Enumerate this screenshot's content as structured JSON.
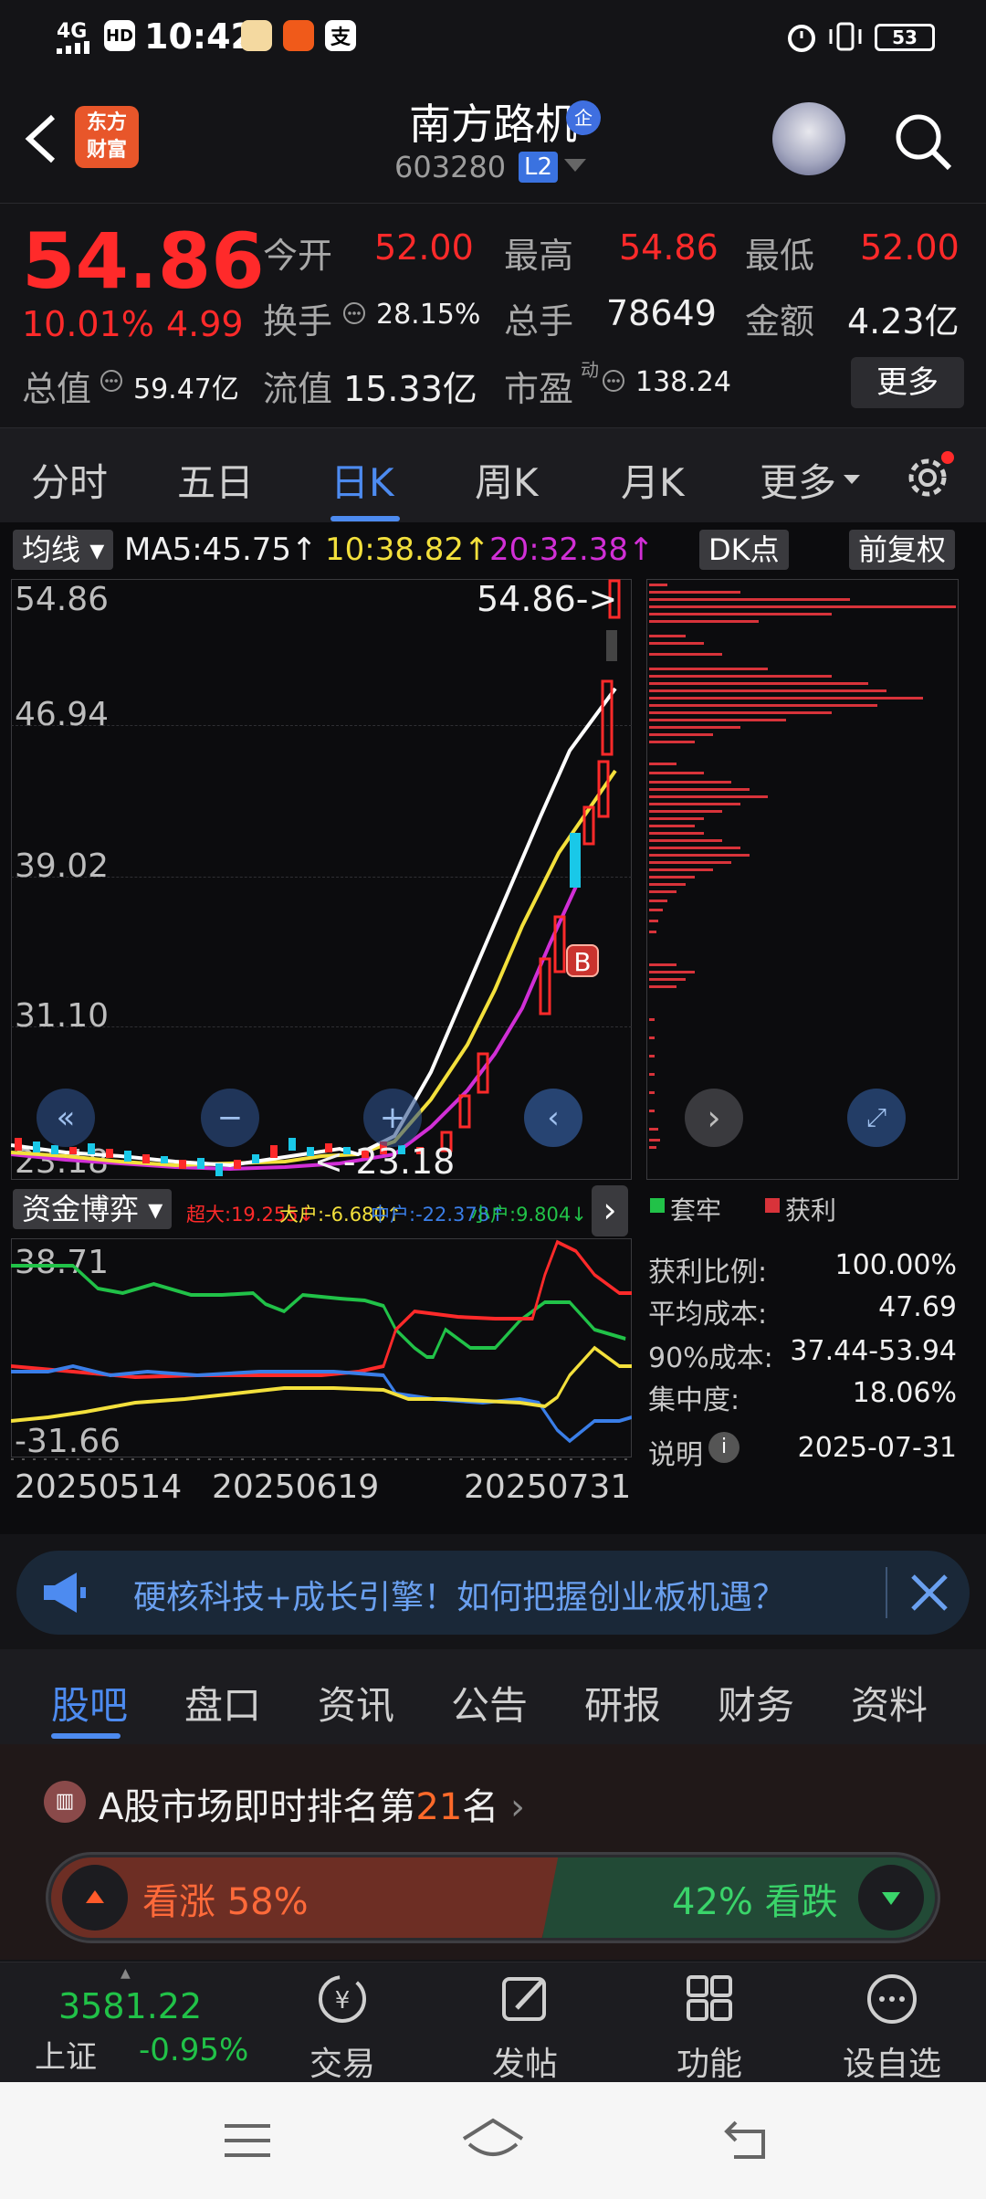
{
  "status": {
    "time": "10:42",
    "network": "4G",
    "battery": "53"
  },
  "header": {
    "name": "南方路机",
    "code": "603280",
    "l2": "L2",
    "badge": "企",
    "logo_line1": "东方",
    "logo_line2": "财富"
  },
  "quote": {
    "price": "54.86",
    "pct": "10.01%",
    "chg": "4.99",
    "fields": {
      "open_label": "今开",
      "open": "52.00",
      "high_label": "最高",
      "high": "54.86",
      "low_label": "最低",
      "low": "52.00",
      "turnover_label": "换手",
      "turnover": "28.15%",
      "volume_label": "总手",
      "volume": "78649",
      "amount_label": "金额",
      "amount": "4.23亿",
      "mcap_label": "总值",
      "mcap": "59.47亿",
      "float_label": "流值",
      "float": "15.33亿",
      "pe_label": "市盈",
      "pe_sup": "动",
      "pe": "138.24"
    },
    "more": "更多"
  },
  "ktabs": [
    "分时",
    "五日",
    "日K",
    "周K",
    "月K",
    "更多"
  ],
  "chart": {
    "ma_selector": "均线",
    "ma5": "MA5:45.75↑",
    "ma10": "10:38.82↑",
    "ma20": "20:32.38↑",
    "dk_button": "DK点",
    "adjust_button": "前复权",
    "yticks": [
      "54.86",
      "46.94",
      "39.02",
      "31.10",
      "23.18"
    ],
    "high_marker": "54.86->",
    "low_marker": "<-23.18",
    "buy_marker": "B",
    "fund_selector": "资金博弈",
    "fund_legend": {
      "super": "超大:19.255↓",
      "big": "大户:-6.680↑",
      "mid": "中户:-22.378↑",
      "small": "小户:9.804↓"
    },
    "fund_ymax": "38.71",
    "fund_ymin": "-31.66",
    "dates": [
      "20250514",
      "20250619",
      "20250731"
    ],
    "colors": {
      "up": "#ff2a2a",
      "down": "#19c8e8",
      "ma5": "#ffffff",
      "ma10": "#f3e03c",
      "ma20": "#d12fd6"
    }
  },
  "chip": {
    "legend_trapped": "套牢",
    "legend_profit": "获利",
    "rows": [
      {
        "label": "获利比例:",
        "value": "100.00%"
      },
      {
        "label": "平均成本:",
        "value": "47.69"
      },
      {
        "label": "90%成本:",
        "value": "37.44-53.94"
      },
      {
        "label": "集中度:",
        "value": "18.06%"
      }
    ],
    "note": "说明",
    "date": "2025-07-31"
  },
  "banner": {
    "text": "硬核科技+成长引擎！如何把握创业板机遇？"
  },
  "btabs": [
    "股吧",
    "盘口",
    "资讯",
    "公告",
    "研报",
    "财务",
    "资料"
  ],
  "rank": {
    "prefix": "A股市场即时排名第",
    "number": "21",
    "suffix": "名",
    "bull": "看涨 58%",
    "bear": "42% 看跌",
    "bull_pct": 58
  },
  "bottom_nav": {
    "index_value": "3581.22",
    "index_name": "上证",
    "index_chg": "-0.95%",
    "items": [
      "交易",
      "发帖",
      "功能",
      "设自选"
    ]
  }
}
